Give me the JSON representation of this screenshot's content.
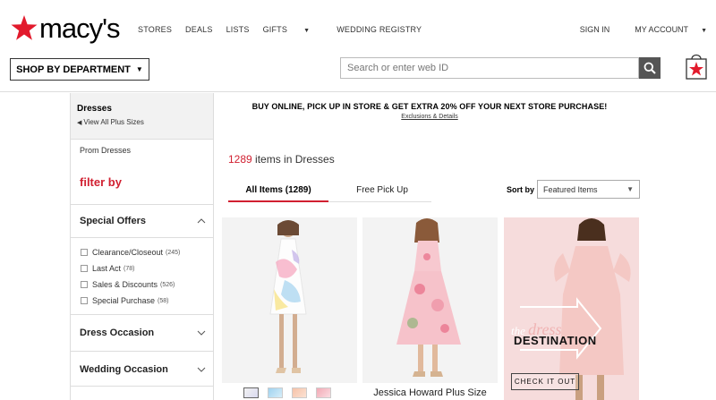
{
  "header": {
    "logo_text": "macy's",
    "nav": [
      "STORES",
      "DEALS",
      "LISTS",
      "GIFTS",
      "WEDDING REGISTRY"
    ],
    "sign_in": "SIGN IN",
    "my_account": "MY ACCOUNT",
    "shop_by_department": "SHOP BY DEPARTMENT",
    "search_placeholder": "Search or enter web ID",
    "brand_red": "#e21a2c"
  },
  "sidebar": {
    "title": "Dresses",
    "view_all": "View All Plus Sizes",
    "prom": "Prom Dresses",
    "filter_by": "filter by",
    "special_offers": {
      "title": "Special Offers",
      "options": [
        {
          "label": "Clearance/Closeout",
          "count": "(245)"
        },
        {
          "label": "Last Act",
          "count": "(78)"
        },
        {
          "label": "Sales & Discounts",
          "count": "(526)"
        },
        {
          "label": "Special Purchase",
          "count": "(58)"
        }
      ]
    },
    "dress_occasion": "Dress Occasion",
    "wedding_occasion": "Wedding Occasion"
  },
  "main": {
    "promo": "BUY ONLINE, PICK UP IN STORE & GET EXTRA 20% OFF YOUR NEXT STORE PURCHASE!",
    "promo_link": "Exclusions & Details",
    "count_num": "1289",
    "count_text": " items in Dresses",
    "tabs": [
      "All Items (1289)",
      "Free Pick Up"
    ],
    "sort_label": "Sort by",
    "sort_value": "Featured Items",
    "ad": {
      "the": "the",
      "dress": "dress",
      "destination": "DESTINATION",
      "cta": "CHECK IT OUT"
    },
    "product2_name": "Jessica Howard Plus Size"
  }
}
